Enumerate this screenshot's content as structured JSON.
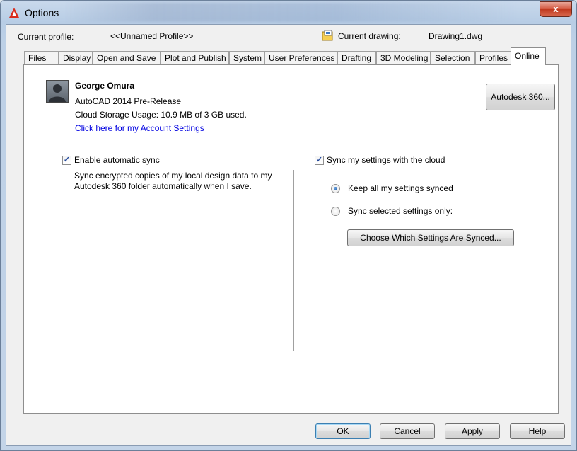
{
  "window": {
    "title": "Options",
    "close_glyph": "x"
  },
  "header": {
    "current_profile_label": "Current profile:",
    "current_profile_value": "<<Unnamed Profile>>",
    "current_drawing_label": "Current drawing:",
    "current_drawing_value": "Drawing1.dwg"
  },
  "tabs": [
    {
      "label": "Files"
    },
    {
      "label": "Display"
    },
    {
      "label": "Open and Save"
    },
    {
      "label": "Plot and Publish"
    },
    {
      "label": "System"
    },
    {
      "label": "User Preferences"
    },
    {
      "label": "Drafting"
    },
    {
      "label": "3D Modeling"
    },
    {
      "label": "Selection"
    },
    {
      "label": "Profiles"
    },
    {
      "label": "Online",
      "active": true
    }
  ],
  "account": {
    "name": "George Omura",
    "product": "AutoCAD 2014 Pre-Release",
    "storage": "Cloud Storage Usage: 10.9 MB of 3 GB used.",
    "settings_link": "Click here for my Account Settings",
    "autodesk360_button": "Autodesk 360..."
  },
  "sync": {
    "enable_auto_sync_label": "Enable automatic sync",
    "enable_auto_sync_checked": true,
    "description_line1": "Sync encrypted copies of my local design data to my",
    "description_line2": "Autodesk 360 folder automatically when I save.",
    "sync_settings_label": "Sync my settings with the cloud",
    "sync_settings_checked": true,
    "keep_all_label": "Keep all my settings synced",
    "keep_all_selected": true,
    "selected_only_label": "Sync selected settings only:",
    "selected_only_selected": false,
    "choose_button": "Choose Which Settings Are Synced..."
  },
  "footer": {
    "ok": "OK",
    "cancel": "Cancel",
    "apply": "Apply",
    "help": "Help"
  },
  "icons": {
    "app": "autocad-logo-icon",
    "drawing": "drawing-file-icon",
    "avatar": "user-avatar-icon",
    "check": "checkmark-icon"
  },
  "colors": {
    "link": "#0000e0",
    "close_button": "#c9442a",
    "app_icon": "#d92b1c"
  }
}
